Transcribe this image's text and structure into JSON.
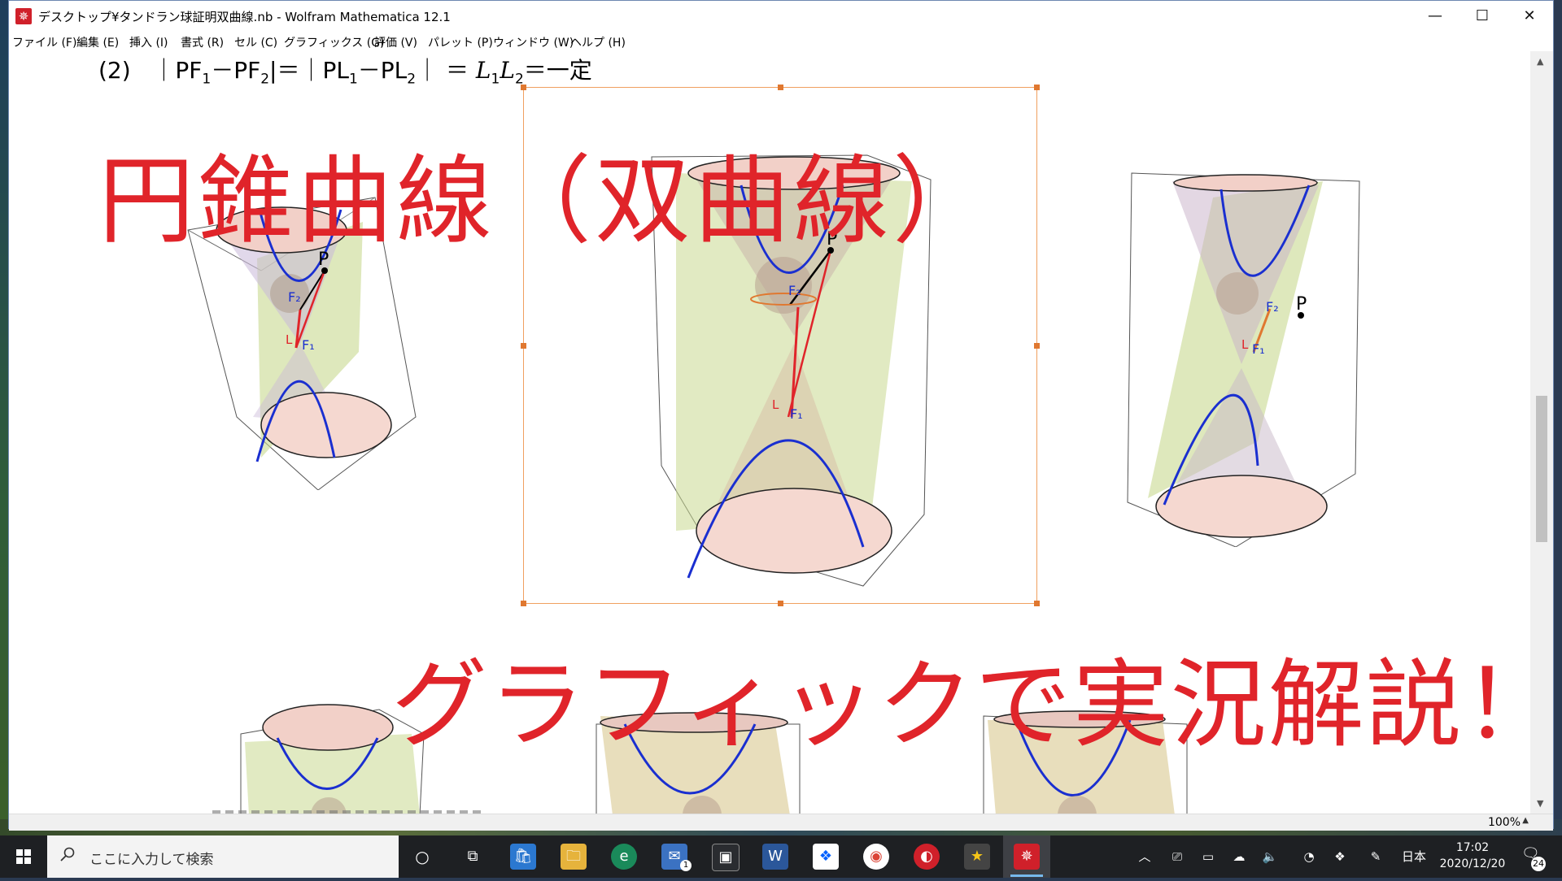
{
  "window": {
    "title": "デスクトップ¥タンドラン球証明双曲線.nb - Wolfram Mathematica 12.1",
    "min": "—",
    "max": "☐",
    "close": "✕"
  },
  "menu": {
    "items": [
      "ファイル (F)",
      "編集 (E)",
      "挿入 (I)",
      "書式 (R)",
      "セル (C)",
      "グラフィックス (G)",
      "評価 (V)",
      "パレット (P)",
      "ウィンドウ (W)",
      "ヘルプ (H)"
    ]
  },
  "notebook": {
    "formula_num": "(2)",
    "formula_a": "｜PF",
    "formula_sub1": "1",
    "formula_b": "－PF",
    "formula_sub2": "2",
    "formula_c": "|＝｜PL",
    "formula_sub3": "1",
    "formula_d": "－PL",
    "formula_sub4": "2",
    "formula_e": "｜ ＝ ",
    "formula_L": "L",
    "formula_sub5": "1",
    "formula_L2": "L",
    "formula_sub6": "2",
    "formula_f": "＝一定",
    "title_overlay": "円錐曲線（双曲線）",
    "subtitle_overlay": "グラフィックで実況解説！",
    "label_P": "P",
    "label_F1": "F₁",
    "label_F2": "F₂",
    "label_L": "L"
  },
  "status": {
    "zoom": "100%"
  },
  "taskbar": {
    "search_placeholder": "ここに入力して検索",
    "time": "17:02",
    "date": "2020/12/20",
    "ime": "日本",
    "notifications": "24",
    "mail_badge": "1"
  },
  "colors": {
    "accent_red": "#e0242a",
    "curve_blue": "#1a2fd0",
    "plane_green": "#c8d890",
    "cone_pink": "#f2d0c8",
    "selection_orange": "#e07830"
  }
}
